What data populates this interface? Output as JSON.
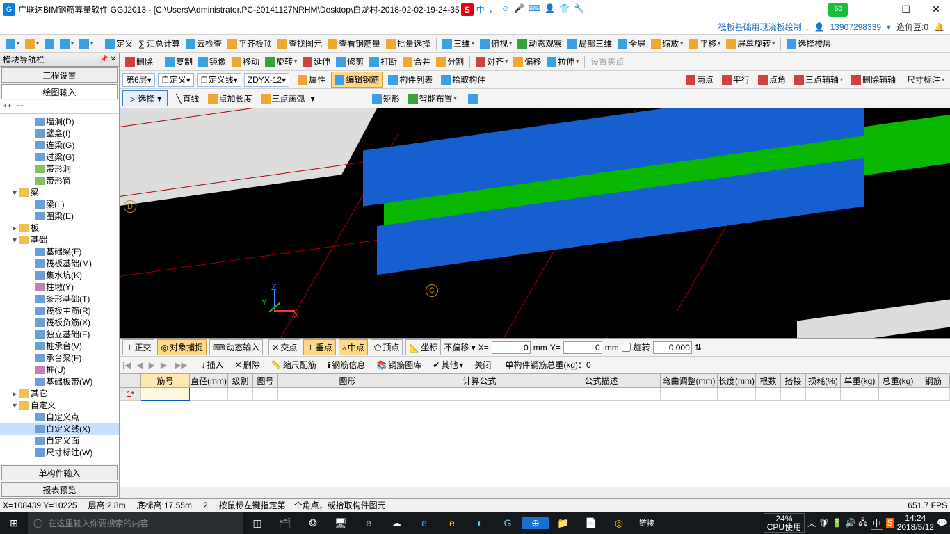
{
  "title": "广联达BIM钢筋算量软件 GGJ2013 - [C:\\Users\\Administrator.PC-20141127NRHM\\Desktop\\白龙村-2018-02-02-19-24-35",
  "ime_letter": "S",
  "ime_cn": "中",
  "green_badge": "60",
  "info": {
    "link": "筏板基础用现浇板绘制...",
    "phone": "13907298339",
    "beans": "造价豆:0"
  },
  "toolbar1": {
    "define": "定义",
    "sum": "∑ 汇总计算",
    "cloud": "云检查",
    "flatroof": "平齐板顶",
    "findgraph": "查找图元",
    "viewrebar": "查看钢筋量",
    "batch": "批量选择",
    "three_d": "三维",
    "top_view": "俯视",
    "dynamic": "动态观察",
    "local3d": "局部三维",
    "full": "全屏",
    "zoom": "缩放",
    "pan": "平移",
    "screen_rot": "屏幕旋转",
    "select_floor": "选择楼层"
  },
  "toolbar2": {
    "del": "删除",
    "copy": "复制",
    "mirror": "镜像",
    "move": "移动",
    "rotate": "旋转",
    "extend": "延伸",
    "trim": "修剪",
    "break": "打断",
    "merge": "合并",
    "split": "分割",
    "align": "对齐",
    "offset": "偏移",
    "stretch": "拉伸",
    "setpoint": "设置夹点"
  },
  "filter": {
    "floor": "第6层",
    "custom": "自定义",
    "customline": "自定义线",
    "code": "ZDYX-12",
    "attr": "属性",
    "editrebar": "编辑钢筋",
    "complist": "构件列表",
    "pickcomp": "拾取构件",
    "twopoint": "两点",
    "parallel": "平行",
    "pointangle": "点角",
    "threeaux": "三点辅轴",
    "delaux": "删除辅轴",
    "dim": "尺寸标注"
  },
  "drawbar": {
    "select": "选择",
    "line": "直线",
    "pointlen": "点加长度",
    "threearc": "三点画弧",
    "rect": "矩形",
    "smart": "智能布置"
  },
  "panel": {
    "header": "模块导航栏",
    "tab_proj": "工程设置",
    "tab_draw": "绘图输入",
    "tab_single": "单构件输入",
    "tab_report": "报表预览"
  },
  "tree": {
    "n1": "墙洞(D)",
    "n2": "壁龛(I)",
    "n3": "连梁(G)",
    "n4": "过梁(G)",
    "n5": "带形洞",
    "n6": "带形窗",
    "g_liang": "梁",
    "n7": "梁(L)",
    "n8": "圈梁(E)",
    "g_ban": "板",
    "g_jichu": "基础",
    "n9": "基础梁(F)",
    "n10": "筏板基础(M)",
    "n11": "集水坑(K)",
    "n12": "柱墩(Y)",
    "n13": "条形基础(T)",
    "n14": "筏板主筋(R)",
    "n15": "筏板负筋(X)",
    "n16": "独立基础(F)",
    "n17": "桩承台(V)",
    "n18": "承台梁(F)",
    "n19": "桩(U)",
    "n20": "基础板带(W)",
    "g_qita": "其它",
    "g_zdy": "自定义",
    "n21": "自定义点",
    "n22": "自定义线(X)",
    "n23": "自定义面",
    "n24": "尺寸标注(W)"
  },
  "snap": {
    "ortho": "正交",
    "osnap": "对象捕捉",
    "dyninput": "动态输入",
    "inter": "交点",
    "perp": "垂点",
    "mid": "中点",
    "apex": "顶点",
    "coord": "坐标",
    "nooffset": "不偏移",
    "x": "X=",
    "xv": "0",
    "xmm": "mm",
    "y": "Y=",
    "yv": "0",
    "ymm": "mm",
    "rot": "旋转",
    "rotv": "0.000"
  },
  "gridtb": {
    "insert": "插入",
    "del": "删除",
    "scale": "缩尺配筋",
    "rebarinfo": "钢筋信息",
    "rebarlib": "钢筋图库",
    "other": "其他",
    "close": "关闭",
    "totalweight": "单构件钢筋总重(kg)：0"
  },
  "cols": {
    "c1": "筋号",
    "c2": "直径(mm)",
    "c3": "级别",
    "c4": "图号",
    "c5": "图形",
    "c6": "计算公式",
    "c7": "公式描述",
    "c8": "弯曲调整(mm)",
    "c9": "长度(mm)",
    "c10": "根数",
    "c11": "搭接",
    "c12": "损耗(%)",
    "c13": "单重(kg)",
    "c14": "总重(kg)",
    "c15": "钢筋"
  },
  "row1": "1*",
  "status": {
    "xy": "X=108439 Y=10225",
    "height": "层高:2.8m",
    "bottom": "底标高:17.55m",
    "num": "2",
    "hint": "按鼠标左键指定第一个角点，或拾取构件图元",
    "fps": "651.7 FPS"
  },
  "taskbar": {
    "search_ph": "在这里输入你要搜索的内容",
    "lianjie": "链接",
    "cpu_pct": "24%",
    "cpu_lbl": "CPU使用",
    "time": "14:24",
    "date": "2018/5/12",
    "ime": "中"
  },
  "axis": {
    "z": "Z",
    "y": "Y",
    "x": "X",
    "d": "D",
    "c": "C"
  }
}
